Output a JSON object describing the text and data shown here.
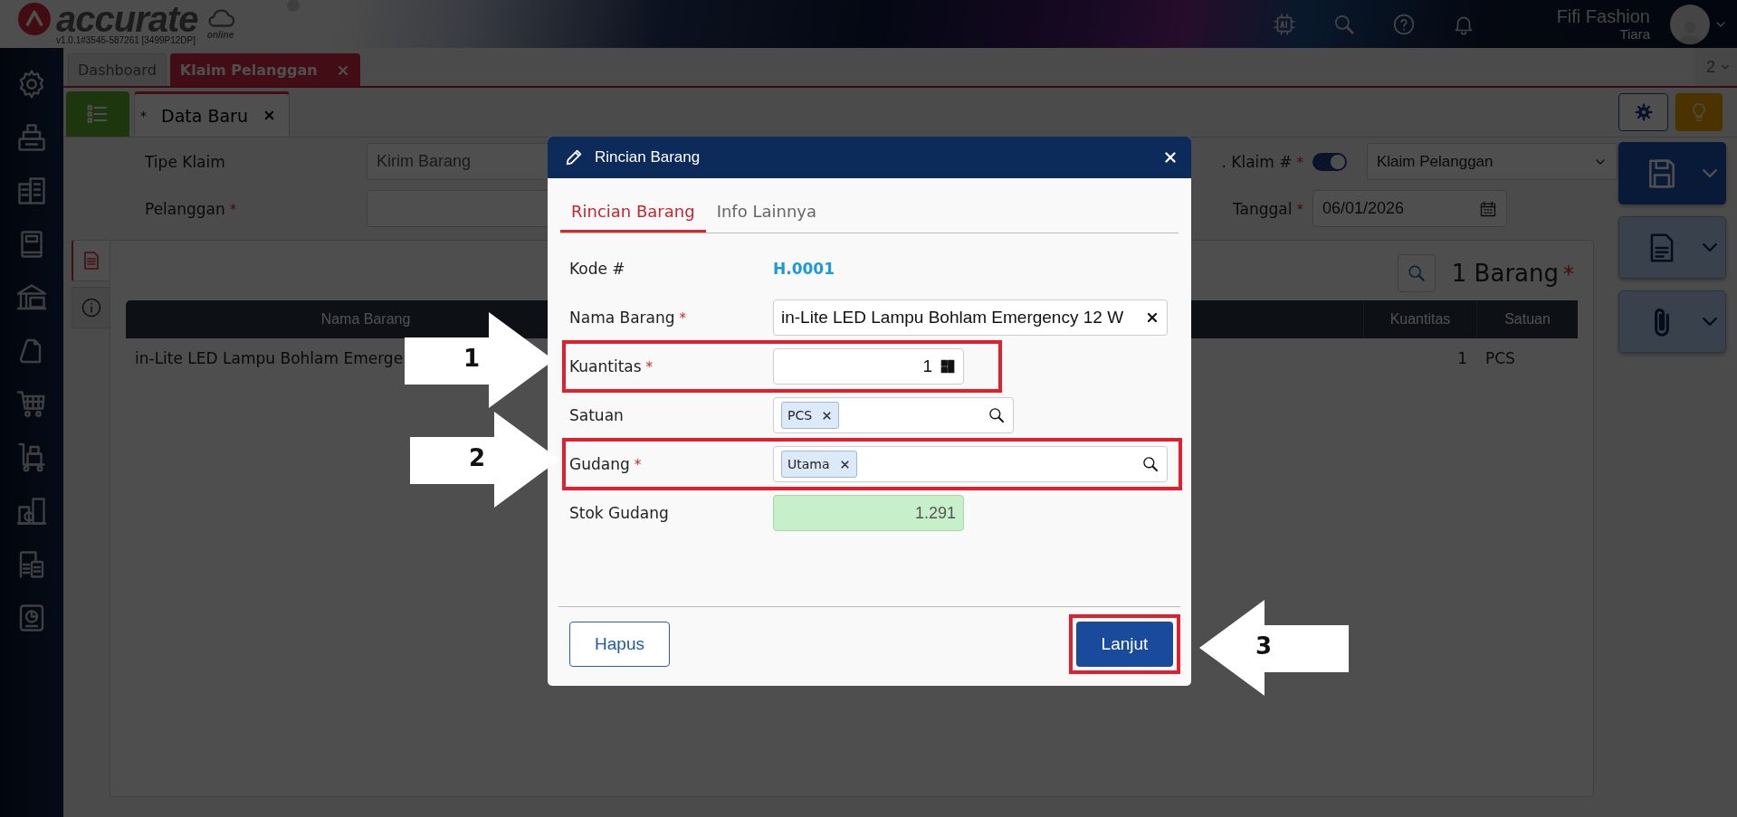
{
  "header": {
    "brand": "accurate",
    "brand_sub": "online",
    "version": "v1.0.1#3545-587261 [3499P12DP]",
    "company": "Fifi Fashion",
    "user": "Tiara"
  },
  "page_tabs": [
    {
      "label": "Dashboard",
      "selected": false
    },
    {
      "label": "Klaim Pelanggan",
      "selected": true
    }
  ],
  "tab_count": "2",
  "doc_tabs": [
    {
      "label": "$^{*}$Data Baru",
      "selected": true
    }
  ],
  "form": {
    "left": [
      {
        "label": "Tipe Klaim",
        "value": "Kirim Barang"
      },
      {
        "label": "Pelanggan",
        "required_mark": "*"
      }
    ],
    "number_label": ". Klaim #",
    "number_required_mark": "*",
    "auto_number": true,
    "number_type": "Klaim Pelanggan",
    "date_label": "Tanggal",
    "date_required_mark": "*",
    "date": "06/01/2026"
  },
  "side_tabs": [
    {
      "kind": "document",
      "selected": true
    },
    {
      "kind": "info",
      "selected": false
    }
  ],
  "items_panel": {
    "title": "1 Barang",
    "required_mark": "*",
    "columns": [
      "Nama Barang",
      "Kuantitas",
      "Satuan"
    ],
    "rows": [
      {
        "cells": [
          "in-Lite LED Lampu Bohlam Emerge",
          "1",
          "PCS"
        ]
      }
    ]
  },
  "dialog": {
    "title": "Rincian Barang",
    "tabs": [
      {
        "label": "Rincian Barang",
        "selected": true
      },
      {
        "label": "Info Lainnya",
        "selected": false
      }
    ],
    "fields": [
      {
        "kind": "link",
        "label": "Kode #",
        "value": "H.0001",
        "highlighted": false
      },
      {
        "kind": "text",
        "label": "Nama Barang",
        "required_mark": "*",
        "value": "in-Lite LED Lampu Bohlam Emergency 12 W",
        "highlighted": false
      },
      {
        "kind": "number",
        "label": "Kuantitas",
        "required_mark": "*",
        "value": "1",
        "highlighted": true
      },
      {
        "kind": "tags",
        "label": "Satuan",
        "tags": [
          "PCS"
        ],
        "wide": false,
        "highlighted": false
      },
      {
        "kind": "tags",
        "label": "Gudang",
        "required_mark": "*",
        "tags": [
          "Utama"
        ],
        "wide": true,
        "highlighted": true
      },
      {
        "kind": "readonly",
        "label": "Stok Gudang",
        "value": "1.291",
        "highlighted": false
      }
    ],
    "buttons": [
      {
        "label": "Hapus",
        "kind": "secondary",
        "highlighted": false
      },
      {
        "label": "Lanjut",
        "kind": "primary",
        "highlighted": true
      }
    ]
  },
  "annotations": [
    {
      "label": "1",
      "kind": "right"
    },
    {
      "label": "2",
      "kind": "right"
    },
    {
      "label": "3",
      "kind": "left"
    }
  ]
}
